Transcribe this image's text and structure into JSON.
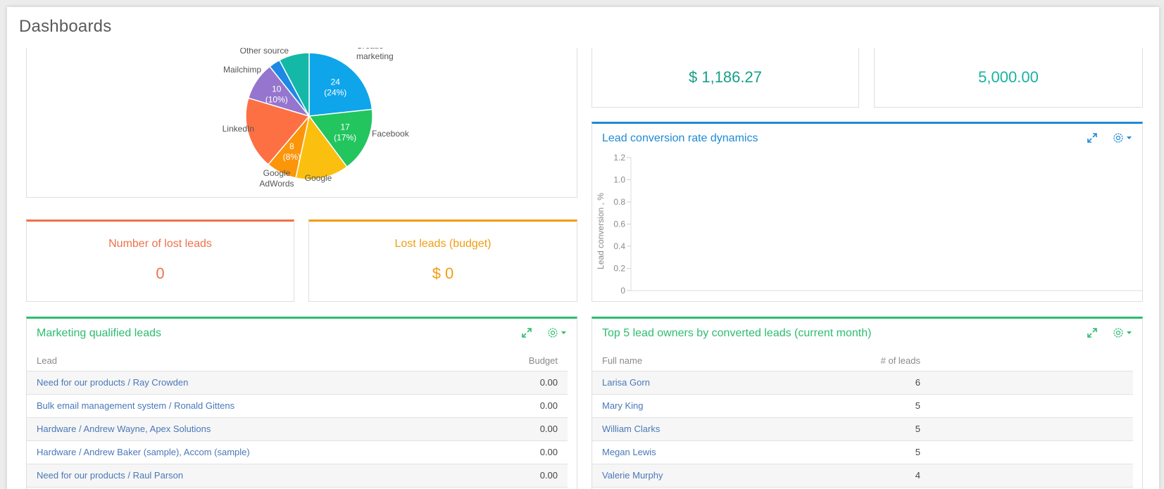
{
  "header": {
    "title": "Dashboards"
  },
  "pie_widget": {
    "chart_data": {
      "type": "pie",
      "title": "",
      "slices": [
        {
          "label": "Creatio marketing",
          "value": 24,
          "percent": "24%",
          "color": "#0ea5ea",
          "show_inner": true
        },
        {
          "label": "Facebook",
          "value": 17,
          "percent": "17%",
          "color": "#22c55e",
          "show_inner": true
        },
        {
          "label": "Google",
          "value": 14,
          "percent": "14%",
          "color": "#fbbf0f",
          "show_inner": false
        },
        {
          "label": "Google AdWords",
          "value": 8,
          "percent": "8%",
          "color": "#fb9509",
          "show_inner": true
        },
        {
          "label": "LinkedIn",
          "value": 19,
          "percent": "19%",
          "color": "#fd7043",
          "show_inner": false
        },
        {
          "label": "Mailchimp",
          "value": 10,
          "percent": "10%",
          "color": "#9575cd",
          "show_inner": true
        },
        {
          "label": "Other source",
          "value": 3,
          "percent": "3%",
          "color": "#1e88e5",
          "show_inner": false
        },
        {
          "label": "",
          "value": 8,
          "percent": "8%",
          "color": "#14b8a6",
          "show_inner": false
        }
      ]
    }
  },
  "kpi_actual": {
    "value": "$ 1,186.27",
    "color": "#17a08a"
  },
  "kpi_planned": {
    "value": "5,000.00",
    "color": "#17b3a0"
  },
  "conversion_widget": {
    "title": "Lead conversion rate dynamics",
    "title_color": "#1e8ad6",
    "chart_data": {
      "type": "line",
      "title": "Lead conversion rate dynamics",
      "xlabel": "",
      "ylabel": "Lead conversion , %",
      "ylim": [
        0,
        1.2
      ],
      "yticks": [
        "0",
        "0.2",
        "0.4",
        "0.6",
        "0.8",
        "1.0",
        "1.2"
      ],
      "series": []
    }
  },
  "lost_count": {
    "title": "Number of lost leads",
    "value": "0",
    "color": "#ef7149"
  },
  "lost_budget": {
    "title": "Lost leads (budget)",
    "value": "$ 0",
    "color": "#f39c12"
  },
  "mql": {
    "title": "Marketing qualified leads",
    "columns": [
      "Lead",
      "Budget"
    ],
    "rows": [
      {
        "lead": "Need for our products / Ray Crowden",
        "budget": "0.00"
      },
      {
        "lead": "Bulk email management system / Ronald Gittens",
        "budget": "0.00"
      },
      {
        "lead": "Hardware / Andrew Wayne, Apex Solutions",
        "budget": "0.00"
      },
      {
        "lead": "Hardware / Andrew Baker (sample), Accom (sample)",
        "budget": "0.00"
      },
      {
        "lead": "Need for our products / Raul Parson",
        "budget": "0.00"
      }
    ]
  },
  "top5": {
    "title": "Top 5 lead owners by converted leads (current month)",
    "columns": [
      "Full name",
      "# of leads"
    ],
    "rows": [
      {
        "name": "Larisa Gorn",
        "count": "6"
      },
      {
        "name": "Mary King",
        "count": "5"
      },
      {
        "name": "William Clarks",
        "count": "5"
      },
      {
        "name": "Megan Lewis",
        "count": "5"
      },
      {
        "name": "Valerie Murphy",
        "count": "4"
      }
    ]
  },
  "icons": {
    "expand": "expand-icon",
    "settings": "gear-icon",
    "dropdown": "caret-down-icon"
  }
}
